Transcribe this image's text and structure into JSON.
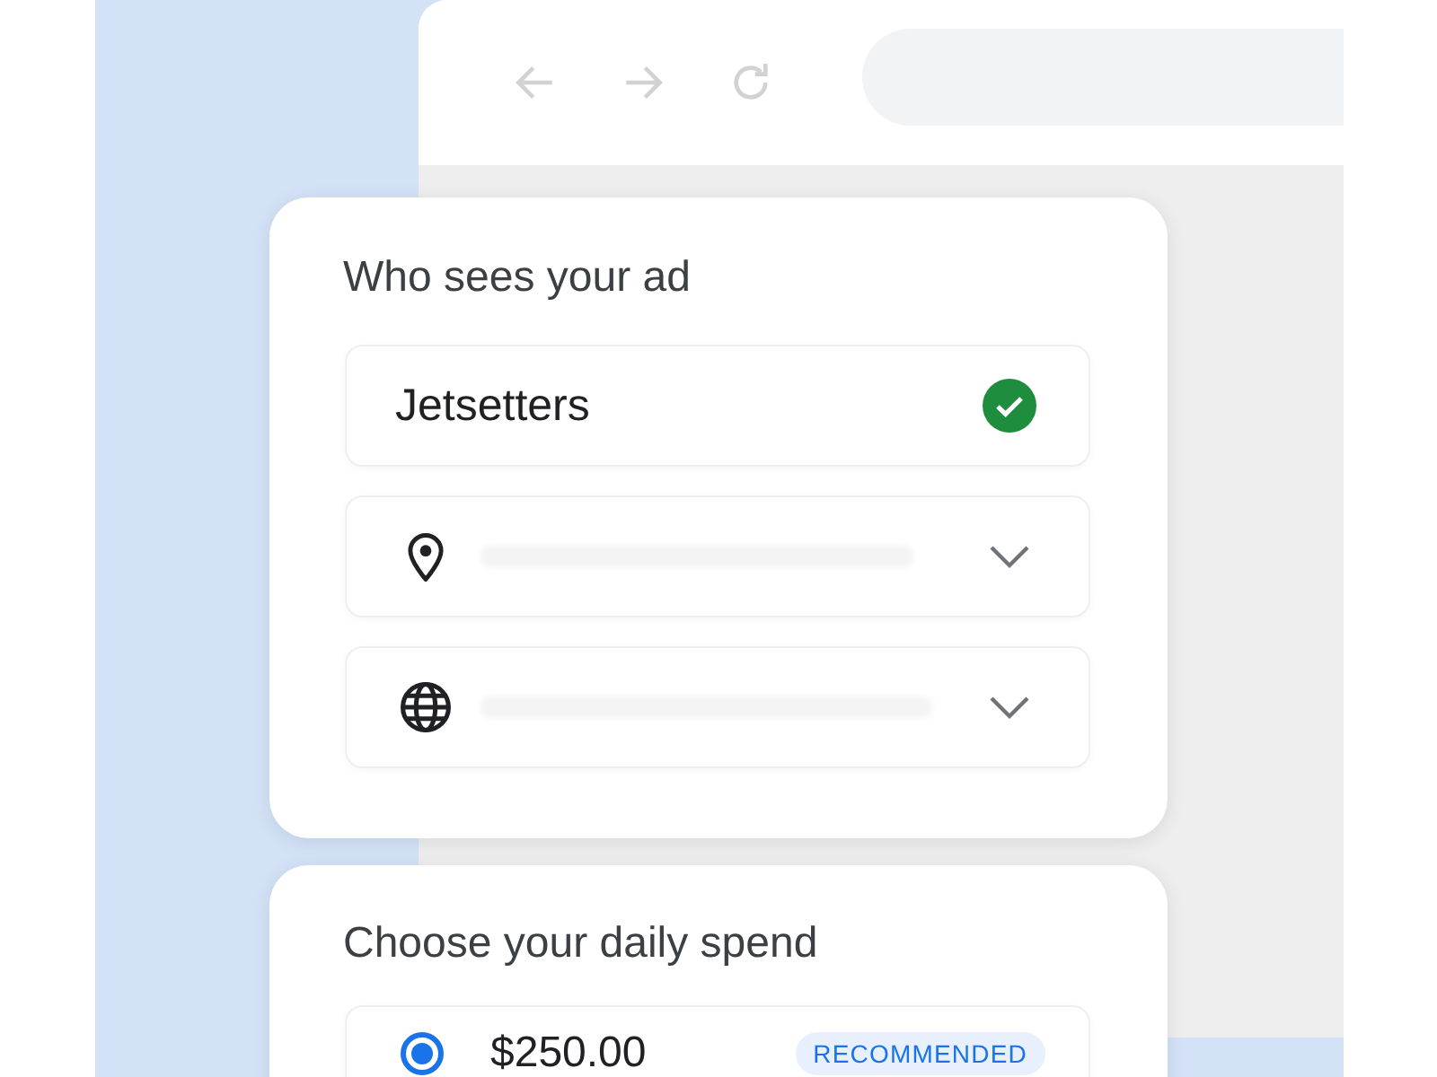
{
  "audience_card": {
    "title": "Who sees your ad",
    "fields": [
      {
        "kind": "audience",
        "value": "Jetsetters",
        "checked": true
      },
      {
        "kind": "location",
        "expanded": false
      },
      {
        "kind": "language",
        "expanded": false
      }
    ]
  },
  "spend_card": {
    "title": "Choose your daily spend",
    "options": [
      {
        "amount": "$250.00",
        "badge": "RECOMMENDED",
        "selected": true
      }
    ]
  }
}
